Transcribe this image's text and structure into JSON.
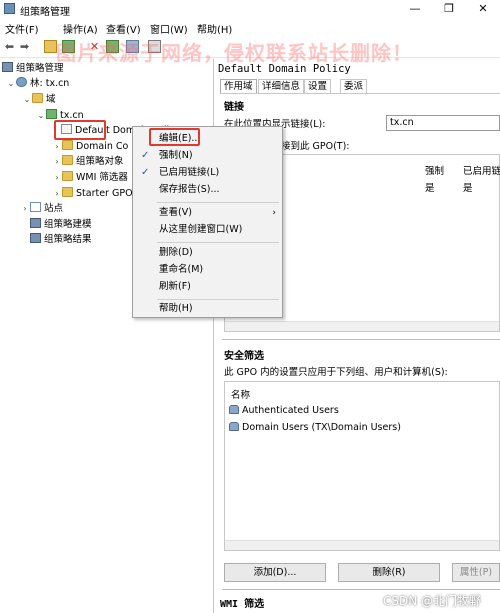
{
  "window": {
    "title": "组策略管理",
    "minimize": "—",
    "maximize": "❐",
    "close": "✕"
  },
  "menu": [
    "文件(F)",
    "操作(A)",
    "查看(V)",
    "窗口(W)",
    "帮助(H)"
  ],
  "watermark": "图片来源于网络，侵权联系站长删除！",
  "tree": {
    "root": "组策略管理",
    "forest": "林: tx.cn",
    "domains": "域",
    "domain": "tx.cn",
    "children": [
      "Default Domain Policy",
      "Domain Co",
      "组策略对象",
      "WMI 筛选器",
      "Starter GPO"
    ],
    "sites": "站点",
    "modeling": "组策略建模",
    "results": "组策略结果"
  },
  "context_menu": {
    "items": [
      {
        "label": "编辑(E)...",
        "checked": false
      },
      {
        "label": "强制(N)",
        "checked": true
      },
      {
        "label": "已启用链接(L)",
        "checked": true
      },
      {
        "label": "保存报告(S)...",
        "checked": false
      },
      {
        "label": "查看(V)",
        "checked": false,
        "submenu": true
      },
      {
        "label": "从这里创建窗口(W)",
        "checked": false
      },
      {
        "label": "删除(D)",
        "checked": false
      },
      {
        "label": "重命名(M)",
        "checked": false
      },
      {
        "label": "刷新(F)",
        "checked": false
      },
      {
        "label": "帮助(H)",
        "checked": false
      }
    ],
    "check_glyph": "✓",
    "submenu_glyph": "›"
  },
  "detail": {
    "policy_title": "Default Domain Policy",
    "tabs": [
      "作用域",
      "详细信息",
      "设置",
      "委派"
    ],
    "links": {
      "heading": "链接",
      "show_label": "在此位置内显示链接(L):",
      "location": "tx.cn",
      "linked_label": "和组织单位链接到此 GPO(T):",
      "columns": [
        "强制",
        "已启用链"
      ],
      "row": [
        "是",
        "是"
      ]
    },
    "security": {
      "heading": "安全筛选",
      "desc": "此 GPO 内的设置只应用于下列组、用户和计算机(S):",
      "column": "名称",
      "entries": [
        "Authenticated Users",
        "Domain Users (TX\\Domain Users)"
      ],
      "buttons": {
        "add": "添加(D)...",
        "remove": "删除(R)",
        "properties": "属性(P)"
      }
    },
    "wmi_heading": "WMI 筛选"
  },
  "footer_credit": "CSDN @北门牧野",
  "colors": {
    "highlight_box": "#e03a2e",
    "check": "#2a5aa8"
  }
}
